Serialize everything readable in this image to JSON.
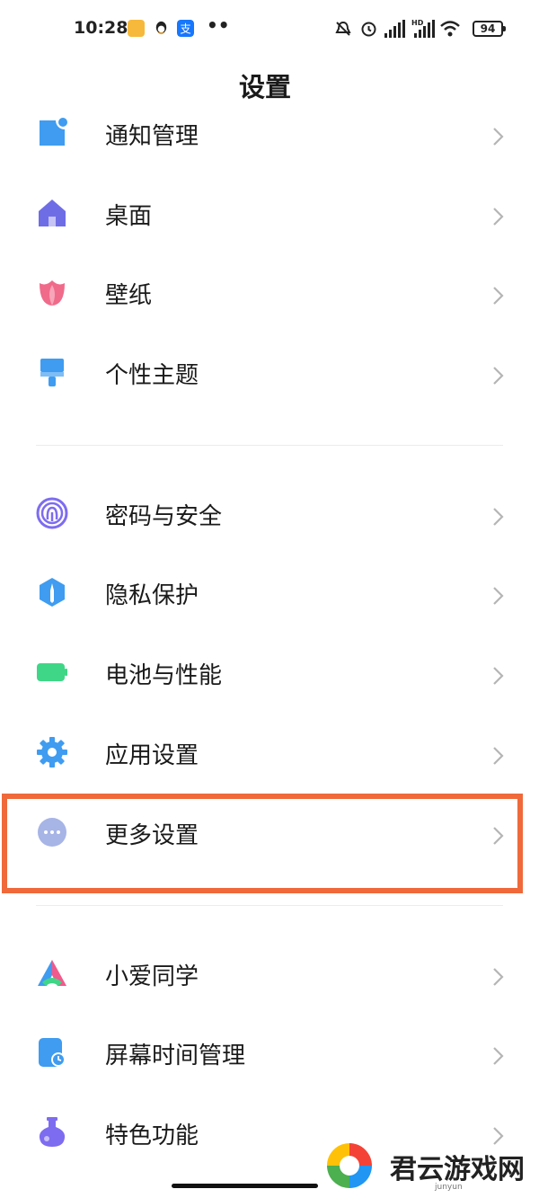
{
  "status_bar": {
    "time": "10:28",
    "battery": "94",
    "dots": "••"
  },
  "header": {
    "title": "设置"
  },
  "groups": [
    {
      "items": [
        {
          "label": "通知管理",
          "icon": "notification-icon",
          "color": "#3f9cf0"
        },
        {
          "label": "桌面",
          "icon": "home-icon",
          "color": "#6f6de6"
        },
        {
          "label": "壁纸",
          "icon": "tulip-icon",
          "color": "#f06a8a"
        },
        {
          "label": "个性主题",
          "icon": "brush-icon",
          "color": "#3f9cf0"
        }
      ]
    },
    {
      "items": [
        {
          "label": "密码与安全",
          "icon": "fingerprint-icon",
          "color": "#7d6cf0"
        },
        {
          "label": "隐私保护",
          "icon": "privacy-shield-icon",
          "color": "#3f9cf0"
        },
        {
          "label": "电池与性能",
          "icon": "battery-icon",
          "color": "#3fd687"
        },
        {
          "label": "应用设置",
          "icon": "gear-icon",
          "color": "#3f9cf0"
        },
        {
          "label": "更多设置",
          "icon": "more-icon",
          "color": "#a7b4e6"
        }
      ]
    },
    {
      "items": [
        {
          "label": "小爱同学",
          "icon": "xiaoai-icon",
          "color": "#f05a8c"
        },
        {
          "label": "屏幕时间管理",
          "icon": "screen-time-icon",
          "color": "#3f9cf0"
        },
        {
          "label": "特色功能",
          "icon": "flask-icon",
          "color": "#7d6cf0"
        }
      ]
    }
  ],
  "watermark": {
    "title": "君云游戏网",
    "subtitle": "junyun"
  }
}
